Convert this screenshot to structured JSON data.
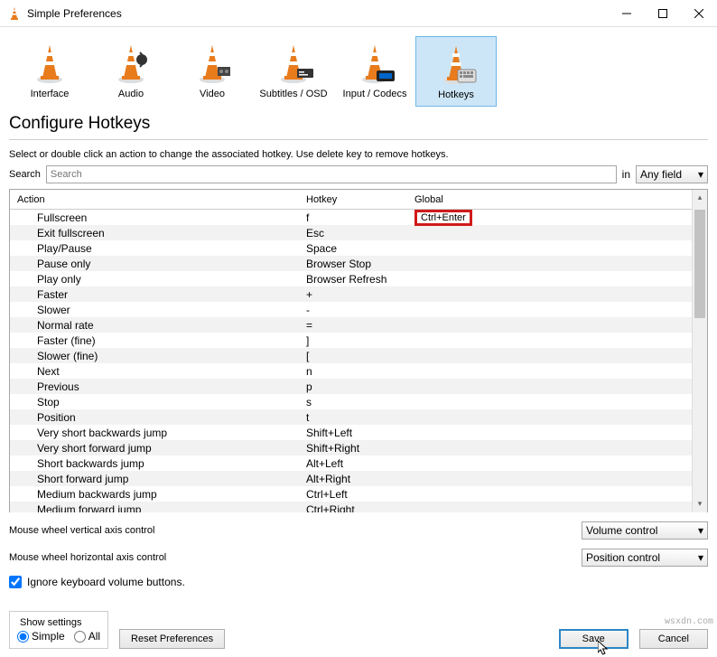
{
  "window": {
    "title": "Simple Preferences"
  },
  "categories": [
    {
      "label": "Interface",
      "icon": "cone-interface"
    },
    {
      "label": "Audio",
      "icon": "cone-audio"
    },
    {
      "label": "Video",
      "icon": "cone-video"
    },
    {
      "label": "Subtitles / OSD",
      "icon": "cone-subtitles"
    },
    {
      "label": "Input / Codecs",
      "icon": "cone-codecs"
    },
    {
      "label": "Hotkeys",
      "icon": "cone-hotkeys",
      "selected": true
    }
  ],
  "heading": "Configure Hotkeys",
  "hint": "Select or double click an action to change the associated hotkey. Use delete key to remove hotkeys.",
  "search": {
    "label": "Search",
    "placeholder": "Search",
    "in": "in",
    "field": "Any field"
  },
  "table": {
    "columns": {
      "action": "Action",
      "hotkey": "Hotkey",
      "global": "Global"
    },
    "rows": [
      {
        "action": "Fullscreen",
        "hotkey": "f",
        "global": "Ctrl+Enter",
        "hl": true
      },
      {
        "action": "Exit fullscreen",
        "hotkey": "Esc",
        "global": ""
      },
      {
        "action": "Play/Pause",
        "hotkey": "Space",
        "global": ""
      },
      {
        "action": "Pause only",
        "hotkey": "Browser Stop",
        "global": ""
      },
      {
        "action": "Play only",
        "hotkey": "Browser Refresh",
        "global": ""
      },
      {
        "action": "Faster",
        "hotkey": "+",
        "global": ""
      },
      {
        "action": "Slower",
        "hotkey": "-",
        "global": ""
      },
      {
        "action": "Normal rate",
        "hotkey": "=",
        "global": ""
      },
      {
        "action": "Faster (fine)",
        "hotkey": "]",
        "global": ""
      },
      {
        "action": "Slower (fine)",
        "hotkey": "[",
        "global": ""
      },
      {
        "action": "Next",
        "hotkey": "n",
        "global": ""
      },
      {
        "action": "Previous",
        "hotkey": "p",
        "global": ""
      },
      {
        "action": "Stop",
        "hotkey": "s",
        "global": ""
      },
      {
        "action": "Position",
        "hotkey": "t",
        "global": ""
      },
      {
        "action": "Very short backwards jump",
        "hotkey": "Shift+Left",
        "global": ""
      },
      {
        "action": "Very short forward jump",
        "hotkey": "Shift+Right",
        "global": ""
      },
      {
        "action": "Short backwards jump",
        "hotkey": "Alt+Left",
        "global": ""
      },
      {
        "action": "Short forward jump",
        "hotkey": "Alt+Right",
        "global": ""
      },
      {
        "action": "Medium backwards jump",
        "hotkey": "Ctrl+Left",
        "global": ""
      },
      {
        "action": "Medium forward jump",
        "hotkey": "Ctrl+Right",
        "global": ""
      }
    ]
  },
  "settings": {
    "wheel_v": {
      "label": "Mouse wheel vertical axis control",
      "value": "Volume control"
    },
    "wheel_h": {
      "label": "Mouse wheel horizontal axis control",
      "value": "Position control"
    },
    "ignore": {
      "label": "Ignore keyboard volume buttons.",
      "checked": true
    }
  },
  "footer": {
    "show_settings": "Show settings",
    "simple": "Simple",
    "all": "All",
    "reset": "Reset Preferences",
    "save": "Save",
    "cancel": "Cancel"
  },
  "watermark": "wsxdn.com"
}
